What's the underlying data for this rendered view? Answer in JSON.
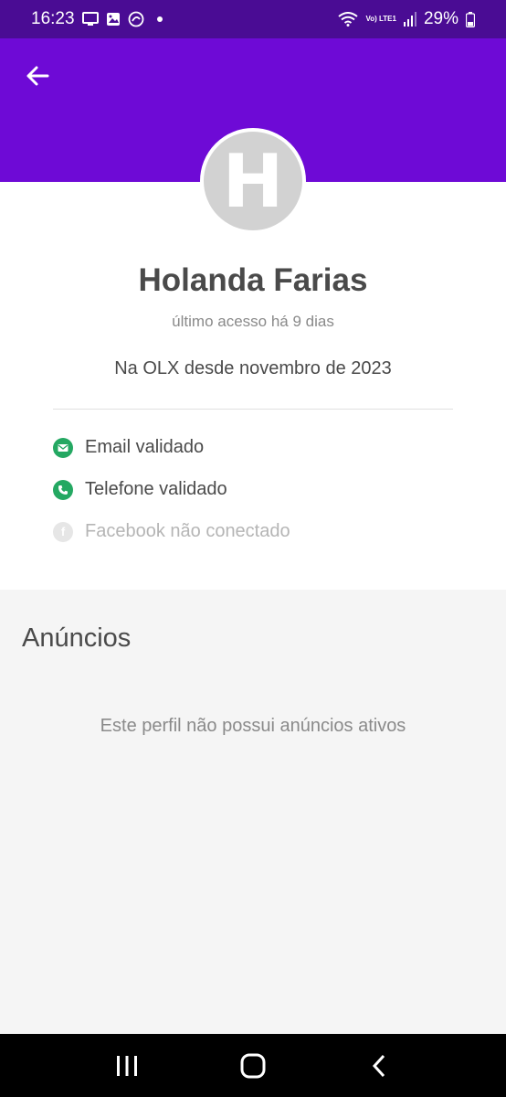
{
  "status_bar": {
    "time": "16:23",
    "battery": "29%",
    "network_label": "Vo) LTE1"
  },
  "profile": {
    "avatar_initial": "H",
    "name": "Holanda Farias",
    "last_access": "último acesso há 9 dias",
    "member_since": "Na OLX desde novembro de 2023",
    "verifications": [
      {
        "label": "Email validado",
        "icon": "email-icon",
        "verified": true
      },
      {
        "label": "Telefone validado",
        "icon": "phone-icon",
        "verified": true
      },
      {
        "label": "Facebook não conectado",
        "icon": "facebook-icon",
        "verified": false
      }
    ]
  },
  "listings": {
    "title": "Anúncios",
    "empty_message": "Este perfil não possui anúncios ativos"
  },
  "colors": {
    "header": "#6e0ad6",
    "status_bar": "#4a0c94",
    "verified": "#24a862"
  }
}
